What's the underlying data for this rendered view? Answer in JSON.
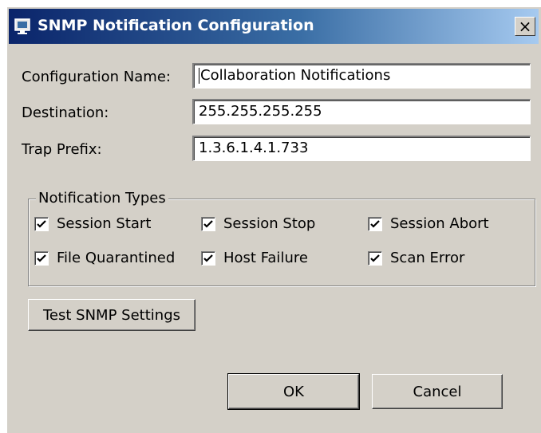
{
  "window": {
    "title": "SNMP Notification Configuration",
    "close_label": "×"
  },
  "form": {
    "config_name_label": "Configuration Name:",
    "config_name_value": "Collaboration Notifications",
    "destination_label": "Destination:",
    "destination_value": "255.255.255.255",
    "trap_prefix_label": "Trap Prefix:",
    "trap_prefix_value": "1.3.6.1.4.1.733"
  },
  "notification_types": {
    "legend": "Notification Types",
    "items": [
      {
        "label": "Session Start",
        "checked": true
      },
      {
        "label": "Session Stop",
        "checked": true
      },
      {
        "label": "Session Abort",
        "checked": true
      },
      {
        "label": "File Quarantined",
        "checked": true
      },
      {
        "label": "Host Failure",
        "checked": true
      },
      {
        "label": "Scan Error",
        "checked": true
      }
    ]
  },
  "buttons": {
    "test_label": "Test SNMP Settings",
    "ok_label": "OK",
    "cancel_label": "Cancel"
  }
}
